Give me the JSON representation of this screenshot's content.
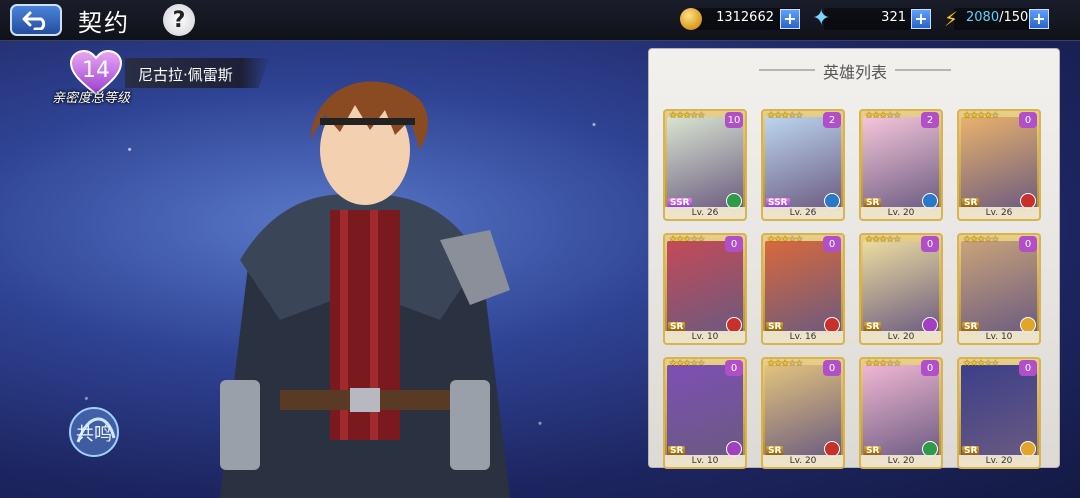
{
  "topbar": {
    "title": "契约",
    "help": "?",
    "resources": [
      {
        "icon": "gold-coin-icon",
        "value": "1312662"
      },
      {
        "icon": "star-crystal-icon",
        "value": "321"
      }
    ],
    "stamina_current": "2080",
    "stamina_max": "/150"
  },
  "character": {
    "affinity_level": "14",
    "name": "尼古拉·佩雷斯",
    "affinity_label": "亲密度总等级",
    "resonance_label": "共鸣"
  },
  "hero_list": {
    "title": "英雄列表",
    "cards": [
      {
        "stars": 3,
        "badge": "10",
        "rarity": "SSR",
        "level": "Lv. 26",
        "class_color": "#2e9b4a",
        "bg": "#d9e4d0"
      },
      {
        "stars": 3,
        "badge": "2",
        "rarity": "SSR",
        "level": "Lv. 26",
        "class_color": "#2b78c9",
        "bg": "#bcd5ef"
      },
      {
        "stars": 3,
        "badge": "2",
        "rarity": "SR",
        "level": "Lv. 20",
        "class_color": "#2b78c9",
        "bg": "#f5c6da"
      },
      {
        "stars": 4,
        "badge": "0",
        "rarity": "SR",
        "level": "Lv. 26",
        "class_color": "#c9302b",
        "bg": "#e9b26c"
      },
      {
        "stars": 3,
        "badge": "0",
        "rarity": "SR",
        "level": "Lv. 10",
        "class_color": "#c9302b",
        "bg": "#c44a57"
      },
      {
        "stars": 3,
        "badge": "0",
        "rarity": "SR",
        "level": "Lv. 16",
        "class_color": "#c9302b",
        "bg": "#d9683c"
      },
      {
        "stars": 3,
        "badge": "0",
        "rarity": "SR",
        "level": "Lv. 20",
        "class_color": "#a23fc0",
        "bg": "#ecdca0"
      },
      {
        "stars": 3,
        "badge": "0",
        "rarity": "SR",
        "level": "Lv. 10",
        "class_color": "#e0a52a",
        "bg": "#c9a37a"
      },
      {
        "stars": 3,
        "badge": "0",
        "rarity": "SR",
        "level": "Lv. 10",
        "class_color": "#a23fc0",
        "bg": "#7d4fb5"
      },
      {
        "stars": 3,
        "badge": "0",
        "rarity": "SR",
        "level": "Lv. 20",
        "class_color": "#c9302b",
        "bg": "#e2c37d"
      },
      {
        "stars": 3,
        "badge": "0",
        "rarity": "SR",
        "level": "Lv. 20",
        "class_color": "#2e9b4a",
        "bg": "#f0b7d3"
      },
      {
        "stars": 3,
        "badge": "0",
        "rarity": "SR",
        "level": "Lv. 20",
        "class_color": "#e0a52a",
        "bg": "#3c3f8a"
      }
    ]
  }
}
